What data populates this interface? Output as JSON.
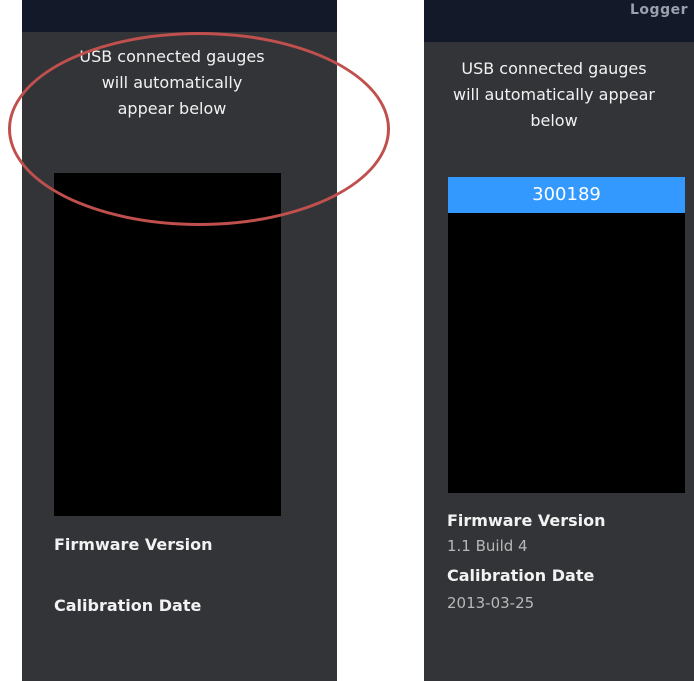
{
  "left_panel": {
    "hint": "USB connected gauges will automatically appear below",
    "firmware_label": "Firmware Version",
    "calibration_label": "Calibration Date"
  },
  "right_panel": {
    "titlebar_text": "Logger",
    "hint": "USB connected gauges will automatically appear below",
    "gauges": [
      "300189"
    ],
    "firmware_label": "Firmware Version",
    "firmware_value": "1.1 Build 4",
    "calibration_label": "Calibration Date",
    "calibration_value": "2013-03-25"
  },
  "annotation": {
    "color": "#c0504d"
  },
  "colors": {
    "panel_bg": "#333438",
    "list_bg": "#000000",
    "selected_item": "#3399ff"
  }
}
